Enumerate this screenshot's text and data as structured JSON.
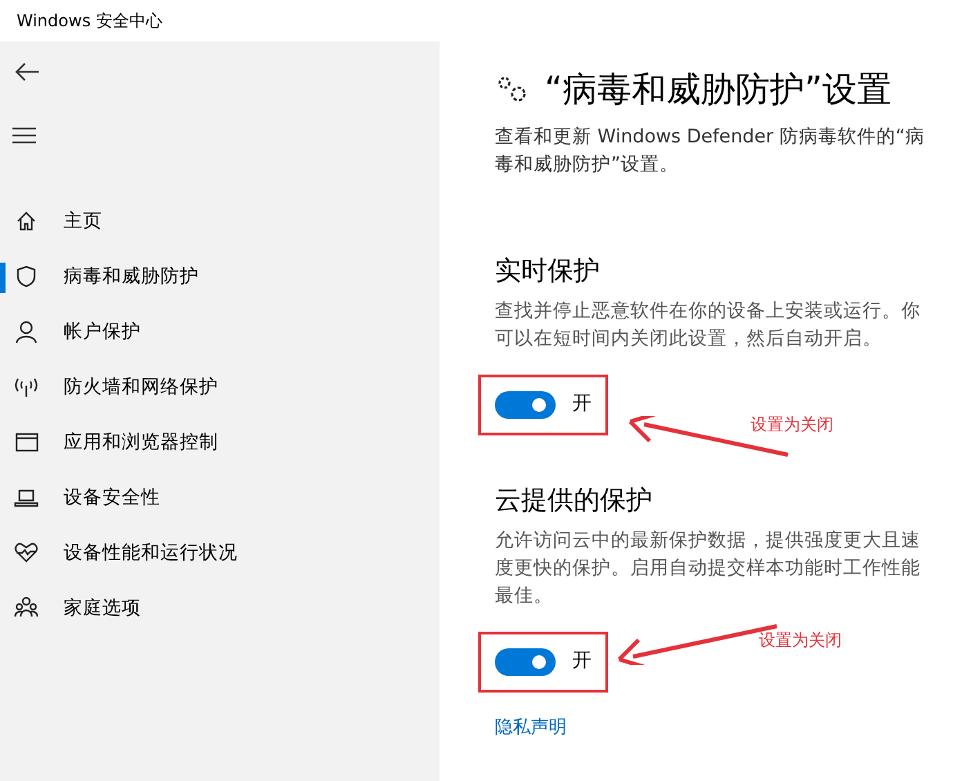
{
  "window": {
    "title": "Windows 安全中心"
  },
  "sidebar": {
    "items": [
      {
        "label": "主页",
        "kind": "home",
        "selected": false
      },
      {
        "label": "病毒和威胁防护",
        "kind": "shield",
        "selected": true
      },
      {
        "label": "帐户保护",
        "kind": "person",
        "selected": false
      },
      {
        "label": "防火墙和网络保护",
        "kind": "antenna",
        "selected": false
      },
      {
        "label": "应用和浏览器控制",
        "kind": "window",
        "selected": false
      },
      {
        "label": "设备安全性",
        "kind": "laptop",
        "selected": false
      },
      {
        "label": "设备性能和运行状况",
        "kind": "heart",
        "selected": false
      },
      {
        "label": "家庭选项",
        "kind": "family",
        "selected": false
      }
    ]
  },
  "page": {
    "title": "“病毒和威胁防护”设置",
    "description": "查看和更新 Windows Defender 防病毒软件的“病毒和威胁防护”设置。"
  },
  "sections": [
    {
      "heading": "实时保护",
      "description": "查找并停止恶意软件在你的设备上安装或运行。你可以在短时间内关闭此设置，然后自动开启。",
      "toggle": {
        "label": "开",
        "on": true
      },
      "annotation": "设置为关闭"
    },
    {
      "heading": "云提供的保护",
      "description": "允许访问云中的最新保护数据，提供强度更大且速度更快的保护。启用自动提交样本功能时工作性能最佳。",
      "toggle": {
        "label": "开",
        "on": true
      },
      "annotation": "设置为关闭"
    }
  ],
  "link": "隐私声明"
}
